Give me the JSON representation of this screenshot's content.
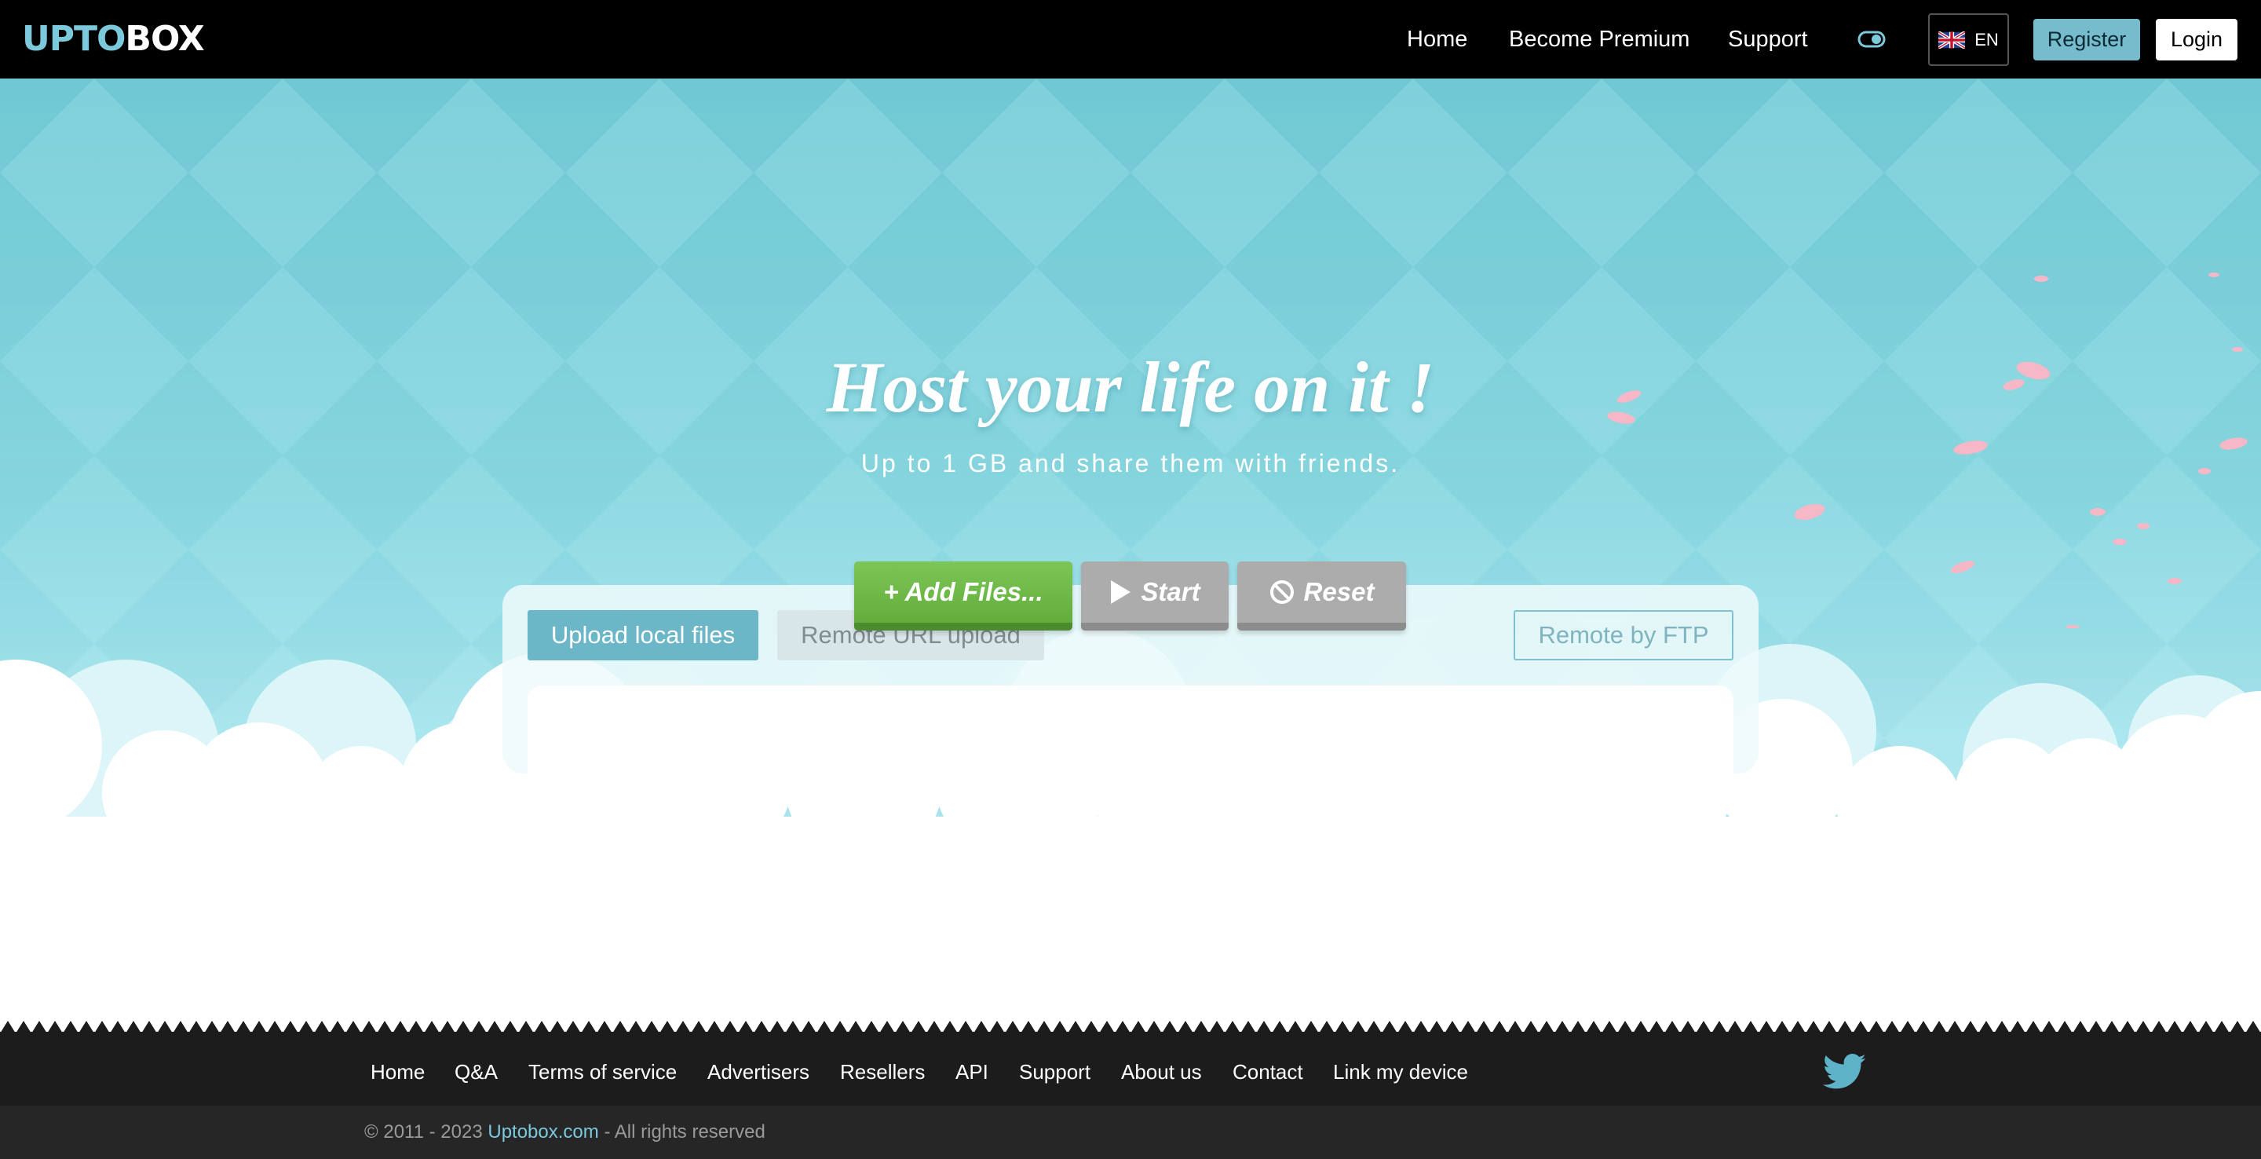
{
  "header": {
    "logo_part1": "UPTO",
    "logo_part2": "BOX",
    "nav": [
      "Home",
      "Become Premium",
      "Support"
    ],
    "theme_toggle_icon": "toggle-icon",
    "language": {
      "flag_icon": "uk-flag-icon",
      "code": "EN"
    },
    "register_label": "Register",
    "login_label": "Login"
  },
  "hero": {
    "title": "Host your life on it !",
    "subtitle": "Up to 1 GB and share them with friends."
  },
  "upload": {
    "tabs": {
      "local": "Upload local files",
      "remote_url": "Remote URL upload",
      "ftp": "Remote by FTP"
    },
    "add_files_label": "+ Add Files...",
    "start_label": "Start",
    "reset_label": "Reset"
  },
  "footer": {
    "links": [
      "Home",
      "Q&A",
      "Terms of service",
      "Advertisers",
      "Resellers",
      "API",
      "Support",
      "About us",
      "Contact",
      "Link my device"
    ],
    "social_icon": "twitter-icon",
    "copyright_prefix": "© 2011 - 2023",
    "copyright_site": "Uptobox.com",
    "copyright_suffix": "- All rights reserved"
  },
  "colors": {
    "accent": "#76bccd",
    "add_button": "#6cb947",
    "neutral_button": "#acacac",
    "header_bg": "#000000",
    "footer_bg": "#1c1c1c"
  }
}
